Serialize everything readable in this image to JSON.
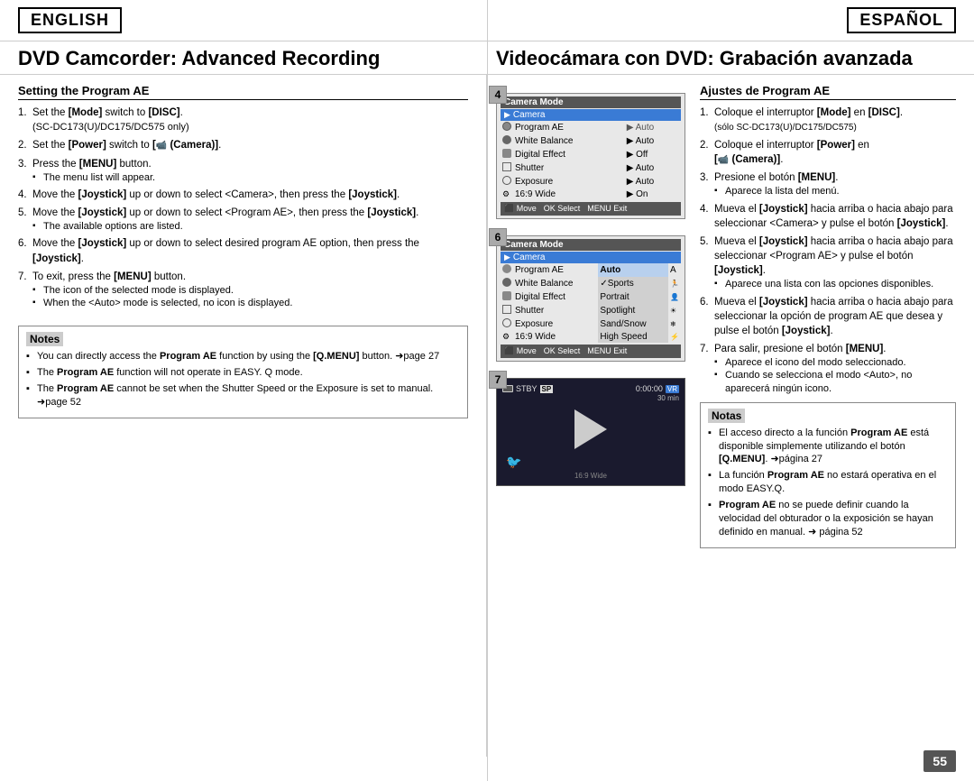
{
  "header": {
    "english_label": "ENGLISH",
    "espanol_label": "ESPAÑOL"
  },
  "titles": {
    "english": "DVD Camcorder: Advanced Recording",
    "espanol": "Videocámara con DVD: Grabación avanzada"
  },
  "english_section": {
    "heading": "Setting the Program AE",
    "steps": [
      {
        "num": "1.",
        "text": "Set the [Mode] switch to [DISC].",
        "sub": "(SC-DC173(U)/DC175/DC575 only)"
      },
      {
        "num": "2.",
        "text": "Set the [Power] switch to [ (Camera)].",
        "sub": null
      },
      {
        "num": "3.",
        "text": "Press the [MENU] button.",
        "sub": "The menu list will appear."
      },
      {
        "num": "4.",
        "text": "Move the [Joystick] up or down to select <Camera>, then press the [Joystick].",
        "sub": null
      },
      {
        "num": "5.",
        "text": "Move the [Joystick] up or down to select <Program AE>, then press the [Joystick].",
        "sub": "The available options are listed."
      },
      {
        "num": "6.",
        "text": "Move the [Joystick] up or down to select desired program AE option, then press the [Joystick].",
        "sub": null
      },
      {
        "num": "7.",
        "text": "To exit, press the [MENU] button.",
        "sub_items": [
          "The icon of the selected mode is displayed.",
          "When the <Auto> mode is selected, no icon is displayed."
        ]
      }
    ],
    "notes_title": "Notes",
    "notes": [
      "You can directly access the Program AE function by using the [Q.MENU] button. ➜page 27",
      "The Program AE function will not operate in EASY. Q mode.",
      "The Program AE cannot be set when the Shutter Speed or the Exposure is set to manual. ➜page 52"
    ]
  },
  "espanol_section": {
    "heading": "Ajustes de Program AE",
    "steps": [
      {
        "num": "1.",
        "text": "Coloque el interruptor [Mode] en [DISC]. (sólo SC-DC173(U)/DC175/DC575)"
      },
      {
        "num": "2.",
        "text": "Coloque el interruptor [Power] en [ (Camera)]."
      },
      {
        "num": "3.",
        "text": "Presione el botón [MENU].",
        "sub": "Aparece la lista del menú."
      },
      {
        "num": "4.",
        "text": "Mueva el [Joystick] hacia arriba o hacia abajo para seleccionar <Camera> y pulse el botón [Joystick]."
      },
      {
        "num": "5.",
        "text": "Mueva el [Joystick] hacia arriba o hacia abajo para seleccionar <Program AE> y pulse el botón [Joystick].",
        "sub": "Aparece una lista con las opciones disponibles."
      },
      {
        "num": "6.",
        "text": "Mueva el [Joystick] hacia arriba o hacia abajo para seleccionar la opción de program AE que desea y pulse el botón [Joystick]."
      },
      {
        "num": "7.",
        "text": "Para salir, presione el botón [MENU].",
        "sub_items": [
          "Aparece el icono del modo seleccionado.",
          "Cuando se selecciona el modo <Auto>, no aparecerá ningún icono."
        ]
      }
    ],
    "notes_title": "Notas",
    "notes": [
      "El acceso directo a la función Program AE está disponible simplemente utilizando el botón [Q.MENU]. ➜página 27",
      "La función Program AE no estará operativa en el modo EASY.Q.",
      "Program AE no se puede definir cuando la velocidad del obturador o la exposición se hayan definido en manual. ➜ página 52"
    ]
  },
  "diagram4": {
    "label": "4",
    "header": "Camera Mode",
    "selected_row": "Camera",
    "rows": [
      {
        "icon": "cam",
        "label": "Camera",
        "selected": true
      },
      {
        "icon": "circle",
        "label": "Program AE",
        "value": "▶ Auto"
      },
      {
        "icon": "circle2",
        "label": "White Balance",
        "value": "▶ Auto"
      },
      {
        "icon": "fx",
        "label": "Digital Effect",
        "value": "▶ Off"
      },
      {
        "icon": "shutter",
        "label": "Shutter",
        "value": "▶ Auto"
      },
      {
        "icon": "exp",
        "label": "Exposure",
        "value": "▶ Auto"
      },
      {
        "icon": "wide",
        "label": "16:9 Wide",
        "value": "▶ On"
      }
    ],
    "footer": "Move   Select   Exit",
    "footer_move": "Move",
    "footer_select": "Select",
    "footer_menu": "MENU",
    "footer_exit": "Exit"
  },
  "diagram6": {
    "label": "6",
    "header": "Camera Mode",
    "selected_row": "Camera",
    "rows": [
      {
        "icon": "cam",
        "label": "Camera"
      },
      {
        "icon": "circle",
        "label": "Program AE",
        "opt": "Auto",
        "opt_selected": true
      },
      {
        "icon": "circle2",
        "label": "White Balance",
        "opt": "✓Sports"
      },
      {
        "icon": "fx",
        "label": "Digital Effect",
        "opt": "Portrait"
      },
      {
        "icon": "shutter",
        "label": "Shutter",
        "opt": "Spotlight"
      },
      {
        "icon": "exp",
        "label": "Exposure",
        "opt": "Sand/Snow"
      },
      {
        "icon": "wide",
        "label": "16:9 Wide",
        "opt": "High Speed"
      }
    ],
    "footer_move": "Move",
    "footer_select": "Select",
    "footer_menu": "MENU",
    "footer_exit": "Exit"
  },
  "diagram7": {
    "label": "7",
    "stby": "STBY",
    "sp": "SP",
    "time": "0:00:00",
    "vr": "VR",
    "min": "30 min",
    "bird_icon": "🐦",
    "wide_label": "16:9 Wide"
  },
  "menu_bar": {
    "move": "Move",
    "select": "Select",
    "menu": "MENU",
    "exit": "Exit"
  },
  "page_number": "55"
}
